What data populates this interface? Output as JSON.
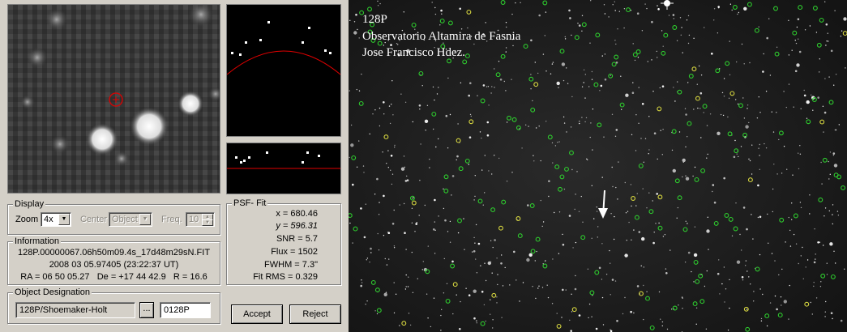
{
  "psf_panel": {
    "display": {
      "title": "Display",
      "zoom_label": "Zoom",
      "zoom_value": "4x",
      "center_label": "Center",
      "center_value": "Object",
      "freq_label": "Freq.",
      "freq_value": "10"
    },
    "information": {
      "title": "Information",
      "filename": "128P.00000067.06h50m09.4s_17d48m29sN.FIT",
      "datetime": "2008 03 05.97405 (23:22:37 UT)",
      "coords": "RA = 06 50 05.27   De = +17 44 42.9   R = 16.6"
    },
    "psf_fit": {
      "title": "PSF- Fit",
      "x": "x = 680.46",
      "y": "y = 596.31",
      "snr": "SNR = 5.7",
      "flux": "Flux = 1502",
      "fwhm": "FWHM = 7.3\"",
      "fit_rms": "Fit RMS = 0.329"
    },
    "object_designation": {
      "title": "Object Designation",
      "name_value": "128P/Shoemaker-Holt",
      "browse_label": "...",
      "code_value": "0128P"
    },
    "buttons": {
      "accept": "Accept",
      "reject": "Reject"
    }
  },
  "sky_image": {
    "caption": [
      "128P",
      "Observatorio Altamira de Fasnia",
      "Jose Francisco Hdez."
    ]
  },
  "icons": [
    "chevron-down-icon",
    "spin-up-icon",
    "spin-down-icon",
    "target-circle-icon",
    "arrow-down-icon"
  ]
}
